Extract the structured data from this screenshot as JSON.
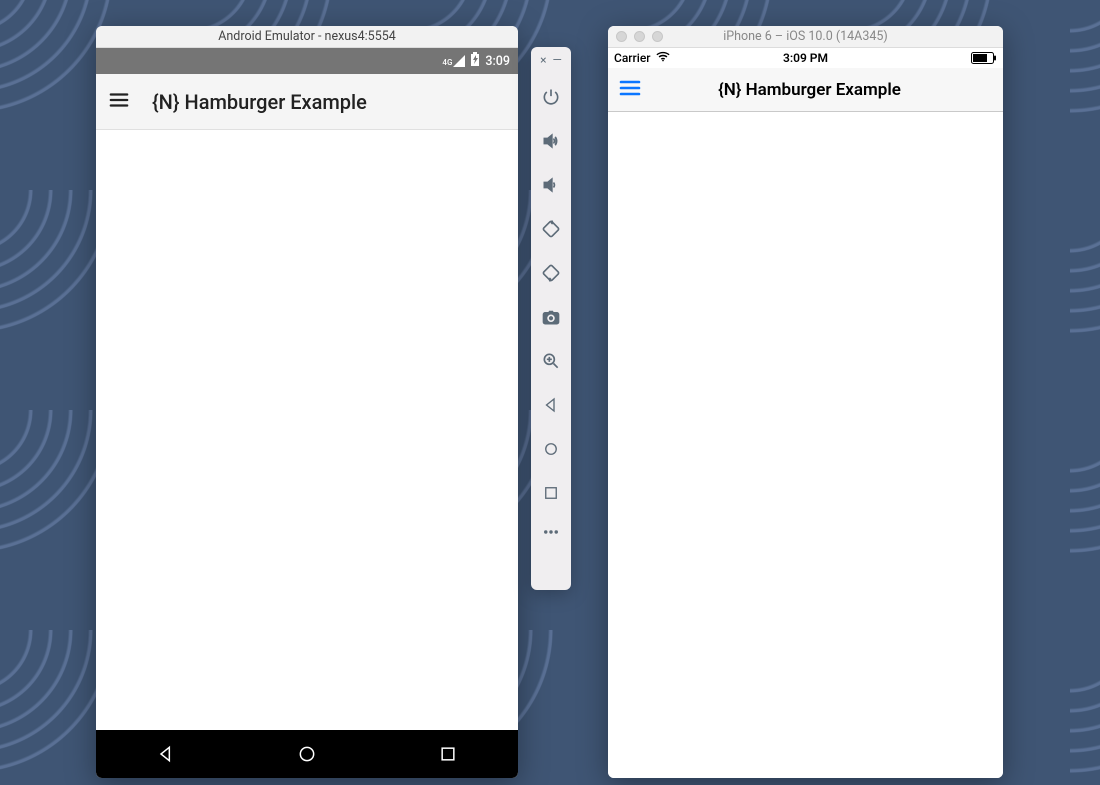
{
  "android": {
    "window_title": "Android Emulator - nexus4:5554",
    "status": {
      "network": "4G",
      "time": "3:09"
    },
    "app": {
      "title": "{N} Hamburger Example"
    }
  },
  "toolbar_icons": {
    "close": "×",
    "minimize": "—"
  },
  "ios": {
    "window_title": "iPhone 6 – iOS 10.0 (14A345)",
    "status": {
      "carrier": "Carrier",
      "time": "3:09 PM"
    },
    "app": {
      "title": "{N} Hamburger Example"
    }
  }
}
